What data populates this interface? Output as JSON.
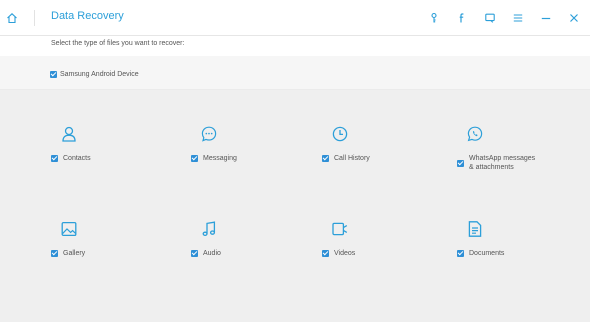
{
  "app": {
    "title": "Data Recovery",
    "accent": "#2c9fd9",
    "toolbar_icons": [
      "home-icon",
      "key-icon",
      "facebook-icon",
      "feedback-icon",
      "menu-icon",
      "minimize-icon",
      "close-icon"
    ]
  },
  "subheader": {
    "text": "Select the type of files you want to recover:"
  },
  "device": {
    "label": "Samsung Android Device",
    "checked": true
  },
  "file_types": [
    {
      "label": "Contacts",
      "icon": "contacts-icon",
      "checked": true
    },
    {
      "label": "Messaging",
      "icon": "messaging-icon",
      "checked": true
    },
    {
      "label": "Call History",
      "icon": "call-history-icon",
      "checked": true
    },
    {
      "label": "WhatsApp messages\n& attachments",
      "icon": "whatsapp-icon",
      "checked": true
    },
    {
      "label": "Gallery",
      "icon": "gallery-icon",
      "checked": true
    },
    {
      "label": "Audio",
      "icon": "audio-icon",
      "checked": true
    },
    {
      "label": "Videos",
      "icon": "videos-icon",
      "checked": true
    },
    {
      "label": "Documents",
      "icon": "documents-icon",
      "checked": true
    }
  ]
}
